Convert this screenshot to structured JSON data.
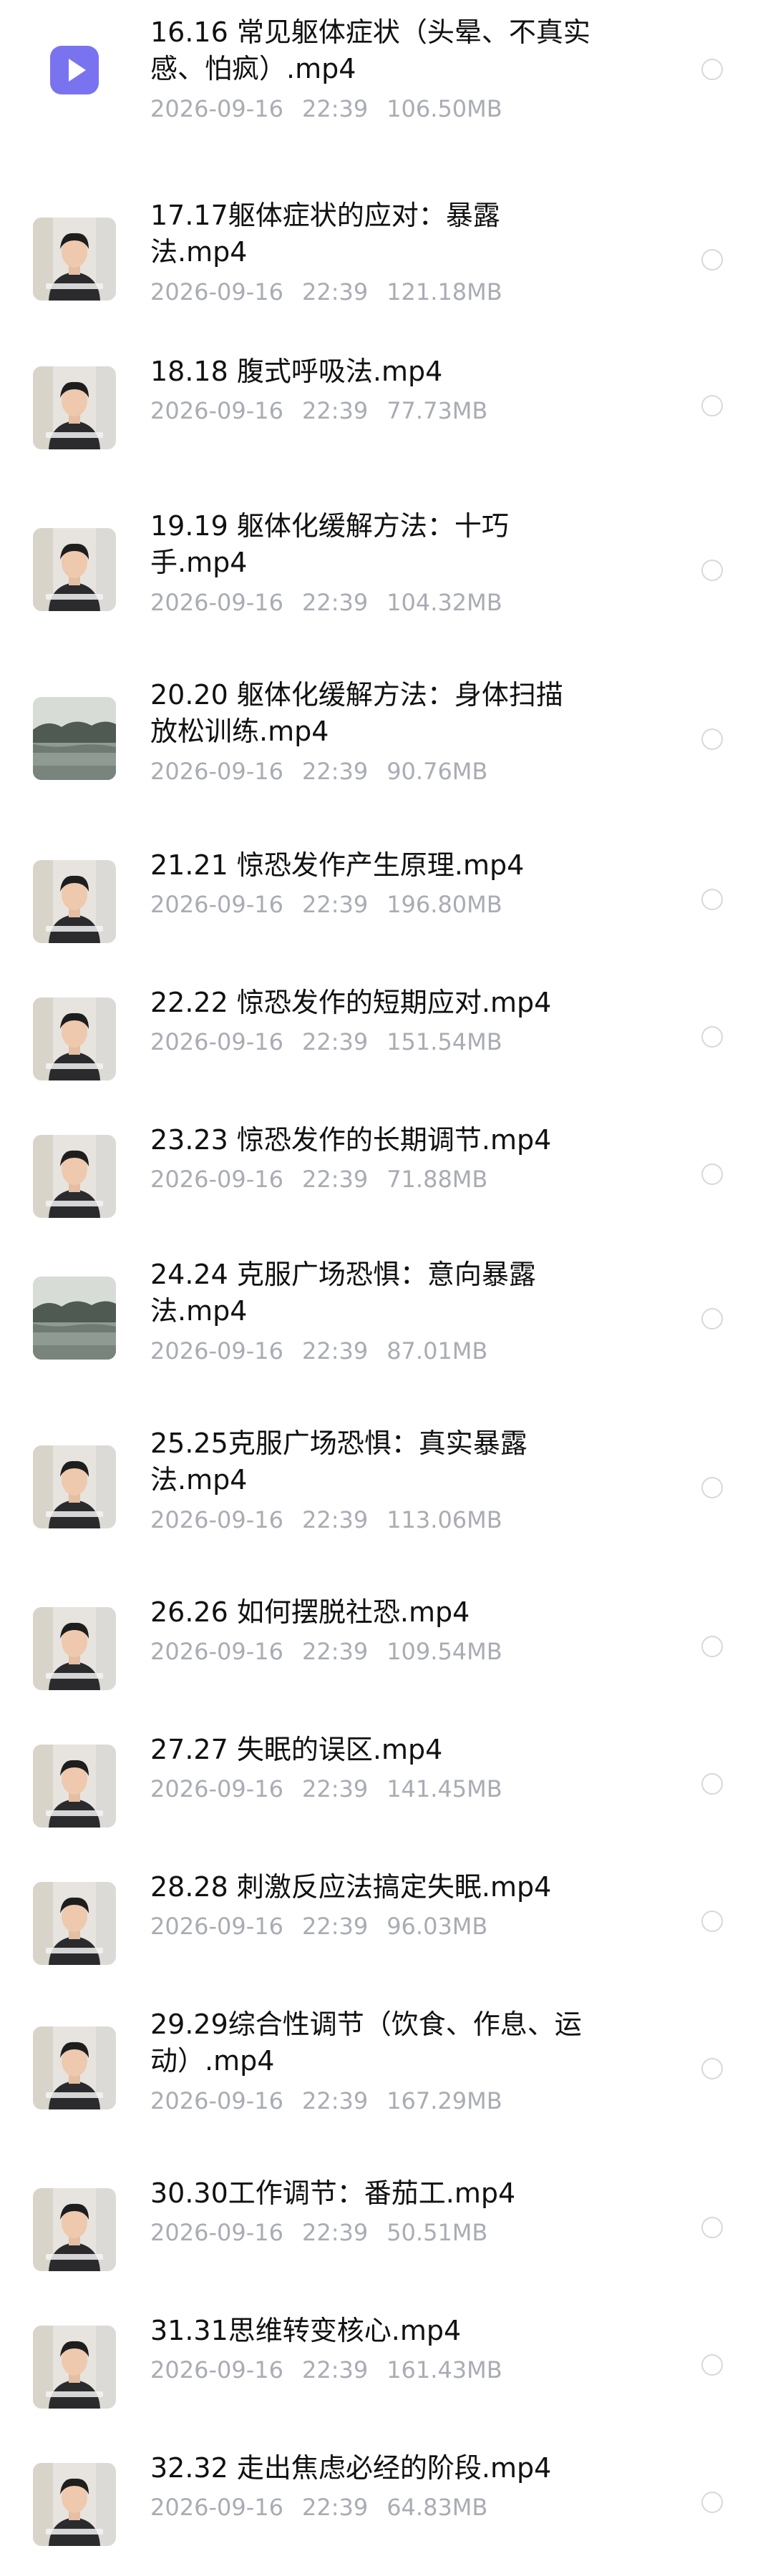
{
  "files": [
    {
      "name": "16.16 常见躯体症状（头晕、不真实感、怕疯）.mp4",
      "name_display": "16.16 常见躯体症状（头晕、不真实\n感、怕疯）.mp4",
      "date": "2026-09-16",
      "time": "22:39",
      "size": "106.50MB",
      "thumb": "video-app-icon"
    },
    {
      "name": "17.17躯体症状的应对：暴露法.mp4",
      "name_display": "17.17躯体症状的应对：暴露\n法.mp4",
      "date": "2026-09-16",
      "time": "22:39",
      "size": "121.18MB",
      "thumb": "presenter-portrait"
    },
    {
      "name": "18.18 腹式呼吸法.mp4",
      "name_display": "18.18 腹式呼吸法.mp4",
      "date": "2026-09-16",
      "time": "22:39",
      "size": "77.73MB",
      "thumb": "presenter-portrait"
    },
    {
      "name": "19.19 躯体化缓解方法：十巧手.mp4",
      "name_display": "19.19 躯体化缓解方法：十巧\n手.mp4",
      "date": "2026-09-16",
      "time": "22:39",
      "size": "104.32MB",
      "thumb": "presenter-portrait"
    },
    {
      "name": "20.20 躯体化缓解方法：身体扫描放松训练.mp4",
      "name_display": "20.20 躯体化缓解方法：身体扫描\n放松训练.mp4",
      "date": "2026-09-16",
      "time": "22:39",
      "size": "90.76MB",
      "thumb": "landscape-lake"
    },
    {
      "name": "21.21 惊恐发作产生原理.mp4",
      "name_display": "21.21 惊恐发作产生原理.mp4",
      "date": "2026-09-16",
      "time": "22:39",
      "size": "196.80MB",
      "thumb": "presenter-portrait"
    },
    {
      "name": "22.22 惊恐发作的短期应对.mp4",
      "name_display": "22.22 惊恐发作的短期应对.mp4",
      "date": "2026-09-16",
      "time": "22:39",
      "size": "151.54MB",
      "thumb": "presenter-portrait"
    },
    {
      "name": "23.23 惊恐发作的长期调节.mp4",
      "name_display": "23.23 惊恐发作的长期调节.mp4",
      "date": "2026-09-16",
      "time": "22:39",
      "size": "71.88MB",
      "thumb": "presenter-portrait"
    },
    {
      "name": "24.24 克服广场恐惧：意向暴露法.mp4",
      "name_display": "24.24 克服广场恐惧：意向暴露\n法.mp4",
      "date": "2026-09-16",
      "time": "22:39",
      "size": "87.01MB",
      "thumb": "landscape-lake"
    },
    {
      "name": "25.25克服广场恐惧：真实暴露法.mp4",
      "name_display": "25.25克服广场恐惧：真实暴露\n法.mp4",
      "date": "2026-09-16",
      "time": "22:39",
      "size": "113.06MB",
      "thumb": "presenter-portrait"
    },
    {
      "name": "26.26 如何摆脱社恐.mp4",
      "name_display": "26.26 如何摆脱社恐.mp4",
      "date": "2026-09-16",
      "time": "22:39",
      "size": "109.54MB",
      "thumb": "presenter-portrait"
    },
    {
      "name": "27.27 失眠的误区.mp4",
      "name_display": "27.27 失眠的误区.mp4",
      "date": "2026-09-16",
      "time": "22:39",
      "size": "141.45MB",
      "thumb": "presenter-portrait"
    },
    {
      "name": "28.28  刺激反应法搞定失眠.mp4",
      "name_display": "28.28  刺激反应法搞定失眠.mp4",
      "date": "2026-09-16",
      "time": "22:39",
      "size": "96.03MB",
      "thumb": "presenter-portrait"
    },
    {
      "name": "29.29综合性调节（饮食、作息、运动）.mp4",
      "name_display": "29.29综合性调节（饮食、作息、运\n动）.mp4",
      "date": "2026-09-16",
      "time": "22:39",
      "size": "167.29MB",
      "thumb": "presenter-portrait"
    },
    {
      "name": "30.30工作调节：番茄工.mp4",
      "name_display": "30.30工作调节：番茄工.mp4",
      "date": "2026-09-16",
      "time": "22:39",
      "size": "50.51MB",
      "thumb": "presenter-portrait"
    },
    {
      "name": "31.31思维转变核心.mp4",
      "name_display": "31.31思维转变核心.mp4",
      "date": "2026-09-16",
      "time": "22:39",
      "size": "161.43MB",
      "thumb": "presenter-portrait"
    },
    {
      "name": "32.32 走出焦虑必经的阶段.mp4",
      "name_display": "32.32 走出焦虑必经的阶段.mp4",
      "date": "2026-09-16",
      "time": "22:39",
      "size": "64.83MB",
      "thumb": "presenter-portrait"
    }
  ],
  "colors": {
    "title": "#111111",
    "meta": "#a9acb3",
    "radio_border": "#d6d8dc",
    "video_icon_bg": "#7a73f0",
    "background": "#ffffff"
  }
}
